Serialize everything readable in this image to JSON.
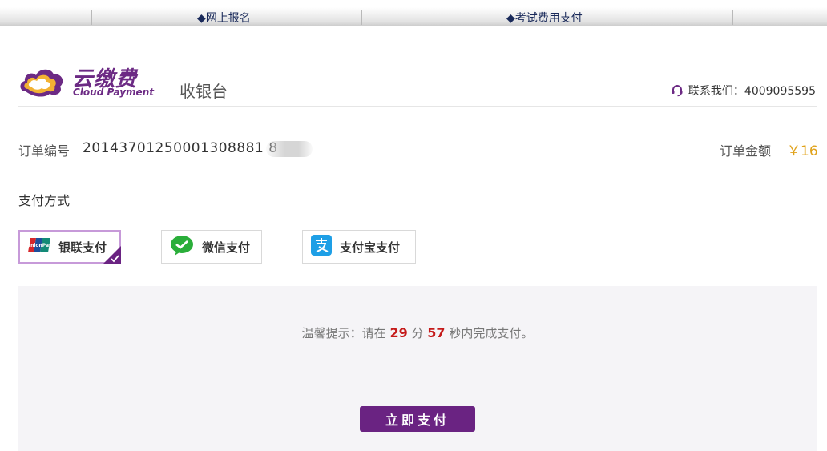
{
  "topnav": {
    "items": [
      {
        "label": "◆网上报名"
      },
      {
        "label": "◆考试费用支付"
      }
    ]
  },
  "header": {
    "brand_cn": "云缴费",
    "brand_en": "Cloud Payment",
    "section": "收银台",
    "contact": "联系我们：4009095595"
  },
  "order": {
    "number_label": "订单编号",
    "number": "20143701250001308881 8",
    "amount_label": "订单金额",
    "amount": "￥16"
  },
  "payment": {
    "label": "支付方式",
    "options": [
      {
        "label": "银联支付",
        "selected": true
      },
      {
        "label": "微信支付",
        "selected": false
      },
      {
        "label": "支付宝支付",
        "selected": false
      }
    ]
  },
  "tip": {
    "prefix": "温馨提示：请在",
    "minutes": "29",
    "min_unit": "分",
    "seconds": "57",
    "suffix": "秒内完成支付。"
  },
  "pay_button": "立即支付",
  "colors": {
    "brand": "#6a2382",
    "amount": "#e0a21a",
    "countdown": "#c51a1a"
  }
}
